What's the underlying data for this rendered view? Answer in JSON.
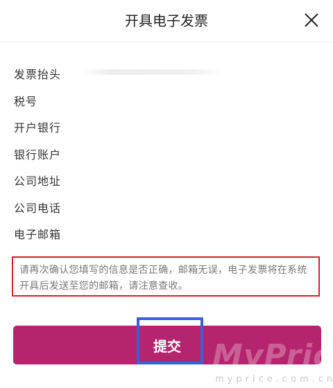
{
  "header": {
    "title": "开具电子发票",
    "close_icon": "close-icon"
  },
  "form": {
    "fields": [
      {
        "label": "发票抬头",
        "value": ""
      },
      {
        "label": "税号",
        "value": ""
      },
      {
        "label": "开户银行",
        "value": ""
      },
      {
        "label": "银行账户",
        "value": ""
      },
      {
        "label": "公司地址",
        "value": ""
      },
      {
        "label": "公司电话",
        "value": ""
      },
      {
        "label": "电子邮箱",
        "value": ""
      }
    ]
  },
  "notice": {
    "text": "请再次确认您填写的信息是否正确，邮箱无误，电子发票将在系统开具后发送至您的邮箱，请注意查收。"
  },
  "submit": {
    "label": "提交"
  },
  "watermark": {
    "brand": "MyPrice",
    "url": "myprice.com.cn"
  },
  "colors": {
    "accent": "#b5246e",
    "notice_border": "#d41f2c",
    "highlight_border": "#3a5fd8"
  }
}
